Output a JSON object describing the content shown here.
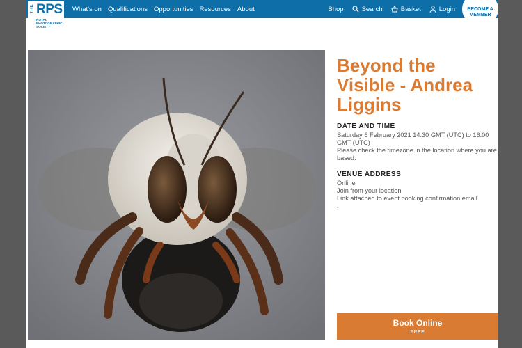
{
  "logo": {
    "the": "THE",
    "rps": "RPS",
    "sub": "ROYAL PHOTOGRAPHIC SOCIETY"
  },
  "nav": {
    "items": [
      "What's on",
      "Qualifications",
      "Opportunities",
      "Resources",
      "About"
    ]
  },
  "right_nav": {
    "shop": "Shop",
    "search": "Search",
    "basket": "Basket",
    "login": "Login"
  },
  "member_button": "BECOME A MEMBER",
  "event": {
    "title": "Beyond the Visible - Andrea Liggins",
    "date_heading": "DATE AND TIME",
    "date_text": "Saturday 6 February 2021 14.30 GMT (UTC) to 16.00 GMT (UTC)",
    "timezone_note": "Please check the timezone in the location where you are based.",
    "venue_heading": "VENUE ADDRESS",
    "venue_lines": [
      "Online",
      "Join from your location",
      "Link attached to event booking confirmation email",
      "."
    ]
  },
  "book": {
    "label": "Book Online",
    "price": "FREE"
  },
  "colors": {
    "brand_blue": "#0e6fa8",
    "accent_orange": "#d97b32"
  }
}
